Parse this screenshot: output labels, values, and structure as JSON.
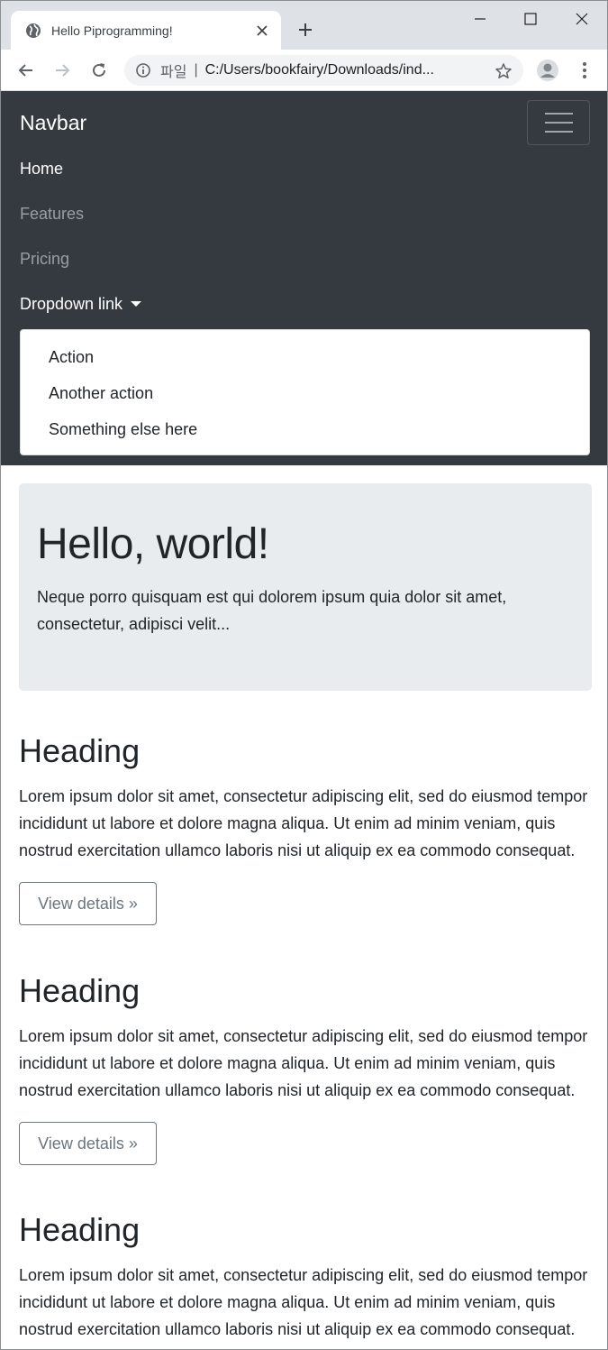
{
  "browser": {
    "tab_title": "Hello Piprogramming!",
    "omnibox_scheme": "파일",
    "omnibox_sep": "|",
    "omnibox_url": "C:/Users/bookfairy/Downloads/ind..."
  },
  "navbar": {
    "brand": "Navbar",
    "links": [
      {
        "label": "Home"
      },
      {
        "label": "Features"
      },
      {
        "label": "Pricing"
      },
      {
        "label": "Dropdown link"
      }
    ],
    "dropdown_items": [
      "Action",
      "Another action",
      "Something else here"
    ]
  },
  "jumbotron": {
    "title": "Hello, world!",
    "text": "Neque porro quisquam est qui dolorem ipsum quia dolor sit amet, consectetur, adipisci velit..."
  },
  "sections": [
    {
      "heading": "Heading",
      "text": "Lorem ipsum dolor sit amet, consectetur adipiscing elit, sed do eiusmod tempor incididunt ut labore et dolore magna aliqua. Ut enim ad minim veniam, quis nostrud exercitation ullamco laboris nisi ut aliquip ex ea commodo consequat.",
      "button": "View details »"
    },
    {
      "heading": "Heading",
      "text": "Lorem ipsum dolor sit amet, consectetur adipiscing elit, sed do eiusmod tempor incididunt ut labore et dolore magna aliqua. Ut enim ad minim veniam, quis nostrud exercitation ullamco laboris nisi ut aliquip ex ea commodo consequat.",
      "button": "View details »"
    },
    {
      "heading": "Heading",
      "text": "Lorem ipsum dolor sit amet, consectetur adipiscing elit, sed do eiusmod tempor incididunt ut labore et dolore magna aliqua. Ut enim ad minim veniam, quis nostrud exercitation ullamco laboris nisi ut aliquip ex ea commodo consequat."
    }
  ],
  "colors": {
    "navbar_bg": "#343a40",
    "jumbotron_bg": "#e9ecef",
    "button_outline": "#6c757d"
  }
}
